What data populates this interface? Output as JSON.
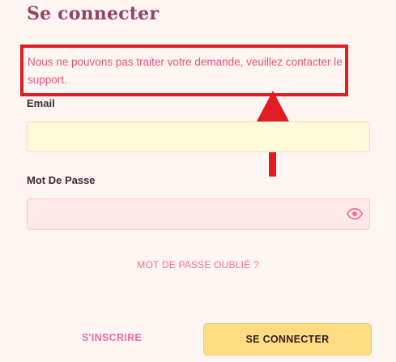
{
  "page": {
    "title": "Se connecter"
  },
  "alert": {
    "message": "Nous ne pouvons pas traiter votre demande, veuillez contacter le support."
  },
  "form": {
    "email_label": "Email",
    "email_value": "",
    "password_label": "Mot De Passe",
    "password_value": "",
    "forgot_password": "MOT DE PASSE OUBLIÉ ?",
    "register": "S'INSCRIRE",
    "submit": "SE CONNECTER"
  },
  "icons": {
    "password_toggle": "eye-icon",
    "annotation": "arrow-up-icon"
  },
  "colors": {
    "title": "#94455e",
    "error": "#e8507e",
    "highlight": "#e01b22",
    "accent": "#f2709a",
    "button": "#ffdc82"
  }
}
